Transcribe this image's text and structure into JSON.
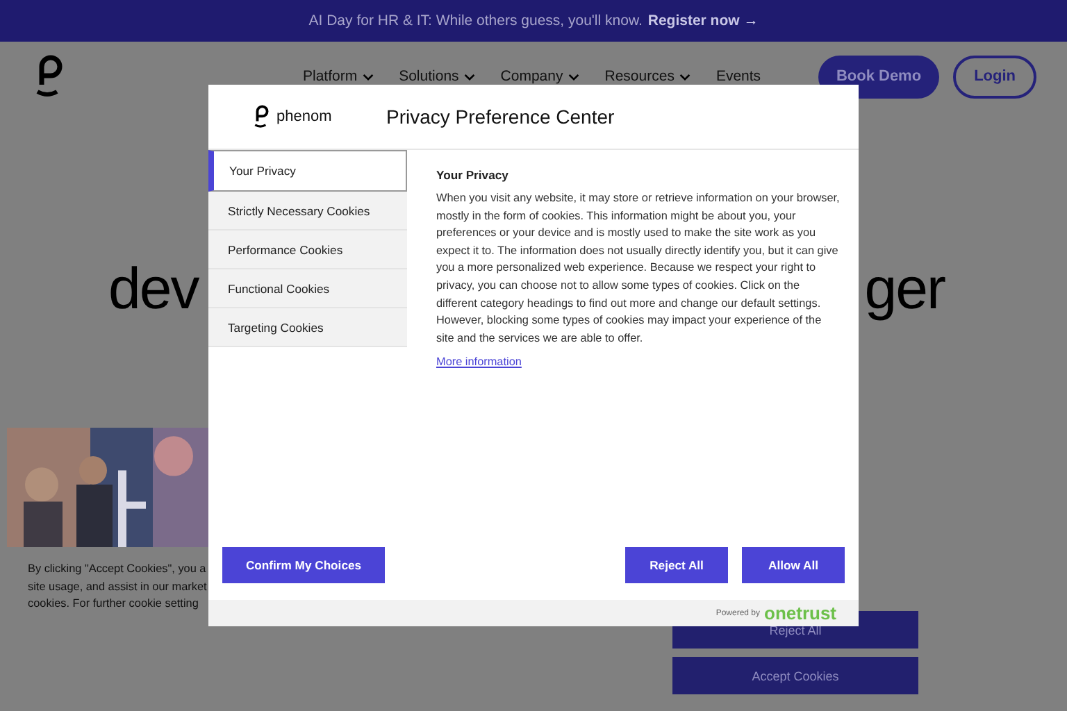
{
  "banner": {
    "text": "AI Day for HR & IT: While others guess, you'll know.",
    "link": "Register now →"
  },
  "nav": {
    "items": [
      {
        "label": "Platform",
        "has_menu": true
      },
      {
        "label": "Solutions",
        "has_menu": true
      },
      {
        "label": "Company",
        "has_menu": true
      },
      {
        "label": "Resources",
        "has_menu": true
      },
      {
        "label": "Events",
        "has_menu": false
      }
    ],
    "buttons": [
      {
        "label": "Book Demo",
        "kind": "filled"
      },
      {
        "label": "Login",
        "kind": "outline"
      }
    ]
  },
  "hero": {
    "left_fragment": "dev",
    "right_fragment": "ger"
  },
  "cookie_banner": {
    "lines": [
      "By clicking \"Accept Cookies\", you a",
      "site usage, and assist in our market",
      "cookies. For further cookie setting"
    ],
    "buttons": [
      "Reject All",
      "Accept Cookies"
    ]
  },
  "modal": {
    "logo_text": "phenom",
    "title": "Privacy Preference Center",
    "tabs": [
      {
        "label": "Your Privacy",
        "selected": true
      },
      {
        "label": "Strictly Necessary Cookies",
        "selected": false
      },
      {
        "label": "Performance Cookies",
        "selected": false
      },
      {
        "label": "Functional Cookies",
        "selected": false
      },
      {
        "label": "Targeting Cookies",
        "selected": false
      }
    ],
    "heading": "Your Privacy",
    "body": "When you visit any website, it may store or retrieve information on your browser, mostly in the form of cookies. This information might be about you, your preferences or your device and is mostly used to make the site work as you expect it to. The information does not usually directly identify you, but it can give you a more personalized web experience. Because we respect your right to privacy, you can choose not to allow some types of cookies. Click on the different category headings to find out more and change our default settings. However, blocking some types of cookies may impact your experience of the site and the services we are able to offer.",
    "link": "More information",
    "buttons": [
      "Confirm My Choices",
      "Reject All",
      "Allow All"
    ],
    "powered_by": {
      "prefix": "Powered by",
      "brand": "onetrust"
    }
  }
}
